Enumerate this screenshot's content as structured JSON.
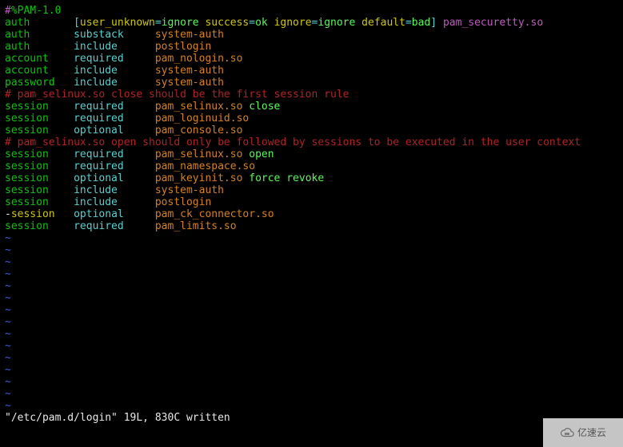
{
  "file_status": "\"/etc/pam.d/login\" 19L, 830C written",
  "watermark": "亿速云",
  "shebang": {
    "hash": "#",
    "rest": "%PAM-1.0"
  },
  "rows": [
    {
      "type": "auth",
      "ctl": "[",
      "pairs": [
        [
          "user_unknown",
          "ignore"
        ],
        [
          "success",
          "ok"
        ],
        [
          "ignore",
          "ignore"
        ],
        [
          "default",
          "bad"
        ]
      ],
      "ctl_close": "]",
      "mod": "pam_securetty.so"
    },
    {
      "type": "auth",
      "ctl_plain": "substack",
      "mod": "system-auth"
    },
    {
      "type": "auth",
      "ctl_plain": "include",
      "mod": "postlogin"
    },
    {
      "type": "account",
      "ctl_plain": "required",
      "mod": "pam_nologin.so"
    },
    {
      "type": "account",
      "ctl_plain": "include",
      "mod": "system-auth"
    },
    {
      "type": "password",
      "ctl_plain": "include",
      "mod": "system-auth"
    },
    {
      "comment": "# pam_selinux.so close should be the first session rule"
    },
    {
      "type": "session",
      "ctl_plain": "required",
      "mod": "pam_selinux.so",
      "arg": "close"
    },
    {
      "type": "session",
      "ctl_plain": "required",
      "mod": "pam_loginuid.so"
    },
    {
      "type": "session",
      "ctl_plain": "optional",
      "mod": "pam_console.so"
    },
    {
      "comment": "# pam_selinux.so open should only be followed by sessions to be executed in the user context"
    },
    {
      "type": "session",
      "ctl_plain": "required",
      "mod": "pam_selinux.so",
      "arg": "open"
    },
    {
      "type": "session",
      "ctl_plain": "required",
      "mod": "pam_namespace.so"
    },
    {
      "type": "session",
      "ctl_plain": "optional",
      "mod": "pam_keyinit.so",
      "arg": "force revoke"
    },
    {
      "type": "session",
      "ctl_plain": "include",
      "mod": "system-auth"
    },
    {
      "type": "session",
      "ctl_plain": "include",
      "mod": "postlogin"
    },
    {
      "leading": "-",
      "type": "session",
      "ctl_plain": "optional",
      "mod": "pam_ck_connector.so"
    },
    {
      "type": "session",
      "ctl_plain": "required",
      "mod": "pam_limits.so"
    }
  ],
  "tilde_rows": 15
}
